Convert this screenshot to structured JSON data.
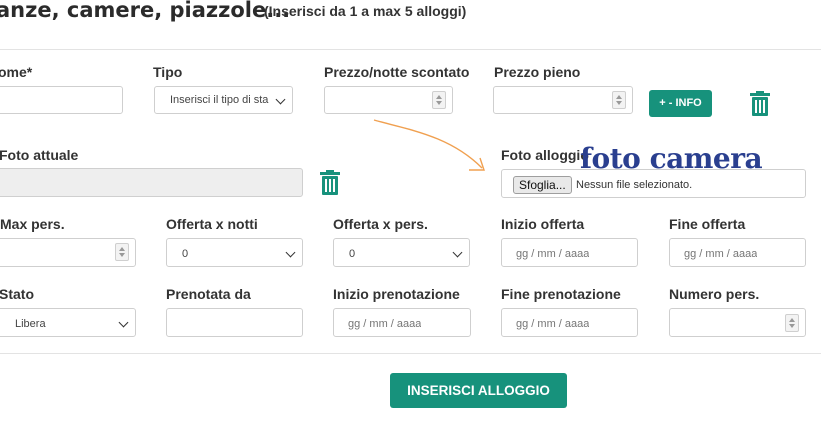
{
  "header": {
    "title": "anze, camere, piazzole...",
    "subtitle": "(Inserisci da 1 a max 5 alloggi)"
  },
  "row1": {
    "name_label": "ome*",
    "type_label": "Tipo",
    "type_value": "Inserisci il tipo di sta",
    "discount_label": "Prezzo/notte scontato",
    "full_label": "Prezzo pieno",
    "info_button": "+ - INFO"
  },
  "row2": {
    "current_photo_label": "Foto attuale",
    "photo_label": "Foto alloggio",
    "browse_button": "Sfoglia...",
    "no_file": "Nessun file selezionato.",
    "overlay": "foto camera"
  },
  "row3": {
    "max_label": "Max pers.",
    "nights_label": "Offerta x notti",
    "nights_value": "0",
    "pers_label": "Offerta x pers.",
    "pers_value": "0",
    "start_label": "Inizio offerta",
    "start_placeholder": "gg / mm / aaaa",
    "end_label": "Fine offerta",
    "end_placeholder": "gg / mm / aaaa"
  },
  "row4": {
    "state_label": "Stato",
    "state_value": "Libera",
    "booked_label": "Prenotata da",
    "bstart_label": "Inizio prenotazione",
    "bstart_placeholder": "gg / mm / aaaa",
    "bend_label": "Fine prenotazione",
    "bend_placeholder": "gg / mm / aaaa",
    "people_label": "Numero pers."
  },
  "submit_label": "INSERISCI ALLOGGIO",
  "colors": {
    "accent": "#17927c",
    "overlay": "#2a3f8f",
    "arrow": "#f0a050"
  }
}
